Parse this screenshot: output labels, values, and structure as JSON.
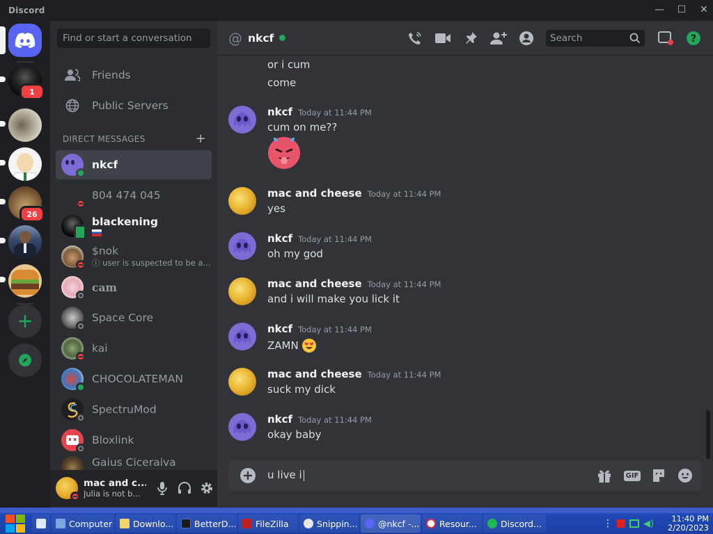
{
  "window": {
    "app_name": "Discord",
    "buttons": [
      "—",
      "☐",
      "✕"
    ]
  },
  "rail": {
    "home_icon": "discord-logo-icon",
    "badges": [
      "1",
      "26"
    ],
    "add_icon": "plus-icon",
    "explore_icon": "compass-icon"
  },
  "sidebar": {
    "search_placeholder": "Find or start a conversation",
    "nav": [
      {
        "label": "Friends",
        "icon": "friends-icon"
      },
      {
        "label": "Public Servers",
        "icon": "globe-icon"
      }
    ],
    "dm_header": "DIRECT MESSAGES",
    "dms": [
      {
        "name": "nkcf",
        "status": "online",
        "sub": "",
        "active": true
      },
      {
        "name": "804 474 045",
        "status": "dnd",
        "sub": ""
      },
      {
        "name": "blackening",
        "status": "mobile",
        "sub": ""
      },
      {
        "name": "$nok",
        "status": "dnd",
        "sub": "ⓘ user is suspected to be a p..."
      },
      {
        "name": "cam",
        "status": "offline",
        "sub": ""
      },
      {
        "name": "Space Core",
        "status": "offline",
        "sub": ""
      },
      {
        "name": "kai",
        "status": "dnd",
        "sub": ""
      },
      {
        "name": "CHOCOLATEMAN",
        "status": "online",
        "sub": ""
      },
      {
        "name": "SpectruMod",
        "status": "offline",
        "sub": ""
      },
      {
        "name": "Bloxlink",
        "status": "offline",
        "sub": ""
      },
      {
        "name": "Gaius Ciceraiva",
        "status": "offline",
        "sub": ""
      }
    ]
  },
  "user_panel": {
    "name": "mac and c...",
    "status": "Julia is not b..."
  },
  "chat": {
    "channel_name": "nkcf",
    "search_placeholder": "Search",
    "continuation": [
      "or i cum",
      "come"
    ],
    "messages": [
      {
        "author": "nkcf",
        "time": "Today at 11:44 PM",
        "text": "cum on me??",
        "emoji": "hot-face-emoji"
      },
      {
        "author": "mac and cheese",
        "time": "Today at 11:44 PM",
        "text": "yes"
      },
      {
        "author": "nkcf",
        "time": "Today at 11:44 PM",
        "text": "oh my god"
      },
      {
        "author": "mac and cheese",
        "time": "Today at 11:44 PM",
        "text": "and i will make you lick it"
      },
      {
        "author": "nkcf",
        "time": "Today at 11:44 PM",
        "text": "ZAMN",
        "emoji": "heart-eyes-emoji"
      },
      {
        "author": "mac and cheese",
        "time": "Today at 11:44 PM",
        "text": "suck my dick"
      },
      {
        "author": "nkcf",
        "time": "Today at 11:44 PM",
        "text": "okay baby"
      }
    ],
    "composer_text": "u live i",
    "gif_label": "GIF"
  },
  "taskbar": {
    "items": [
      "Computer",
      "Downlo...",
      "BetterD...",
      "FileZilla",
      "Snippin...",
      "@nkcf -...",
      "Resour...",
      "Discord..."
    ],
    "clock_time": "11:40 PM",
    "clock_date": "2/20/2023"
  },
  "colors": {
    "blurple": "#5865f2",
    "online": "#23a55a",
    "dnd": "#f23f43",
    "bg_chat": "#313338",
    "bg_sidebar": "#2b2d31"
  }
}
